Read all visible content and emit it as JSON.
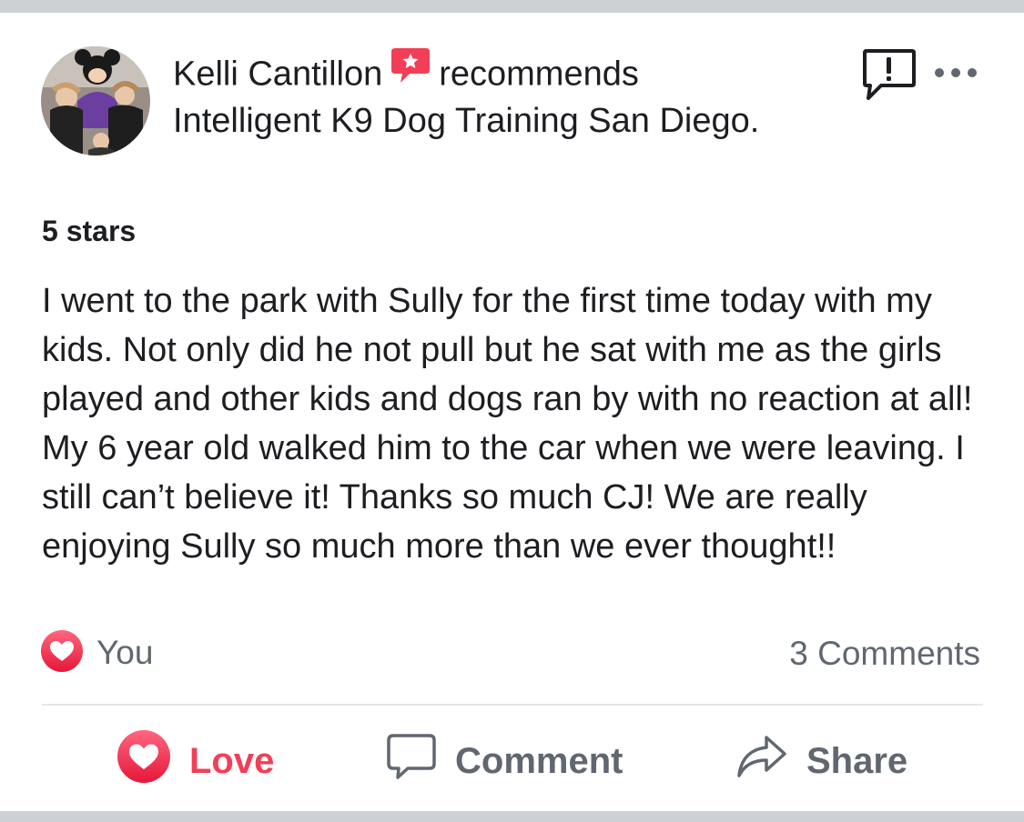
{
  "post": {
    "author": "Kelli Cantillon",
    "action_verb": "recommends",
    "page_name": "Intelligent K9 Dog Training San Diego.",
    "rating_label": "5 stars",
    "body": "I went to the park with Sully for the first time today with my kids. Not only did he not pull but he sat with me as the girls played and other kids and dogs ran by with no reaction at all! My 6 year old walked him to the car when we were leaving. I still can’t believe it! Thanks so much CJ! We are really enjoying Sully so much more than we ever thought!!"
  },
  "reactions": {
    "summary": "You",
    "comments_label": "3 Comments"
  },
  "actions": {
    "love": "Love",
    "comment": "Comment",
    "share": "Share"
  },
  "icons": {
    "avatar": "profile-photo",
    "recommend": "recommend-badge-icon",
    "report": "report-icon",
    "more": "more-options-icon",
    "reaction": "heart-reaction-icon",
    "love": "heart-icon",
    "comment": "speech-bubble-icon",
    "share": "share-arrow-icon"
  },
  "colors": {
    "love_red": "#f33e58",
    "text_primary": "#1c1e21",
    "text_secondary": "#606770",
    "divider": "#e4e6eb"
  }
}
